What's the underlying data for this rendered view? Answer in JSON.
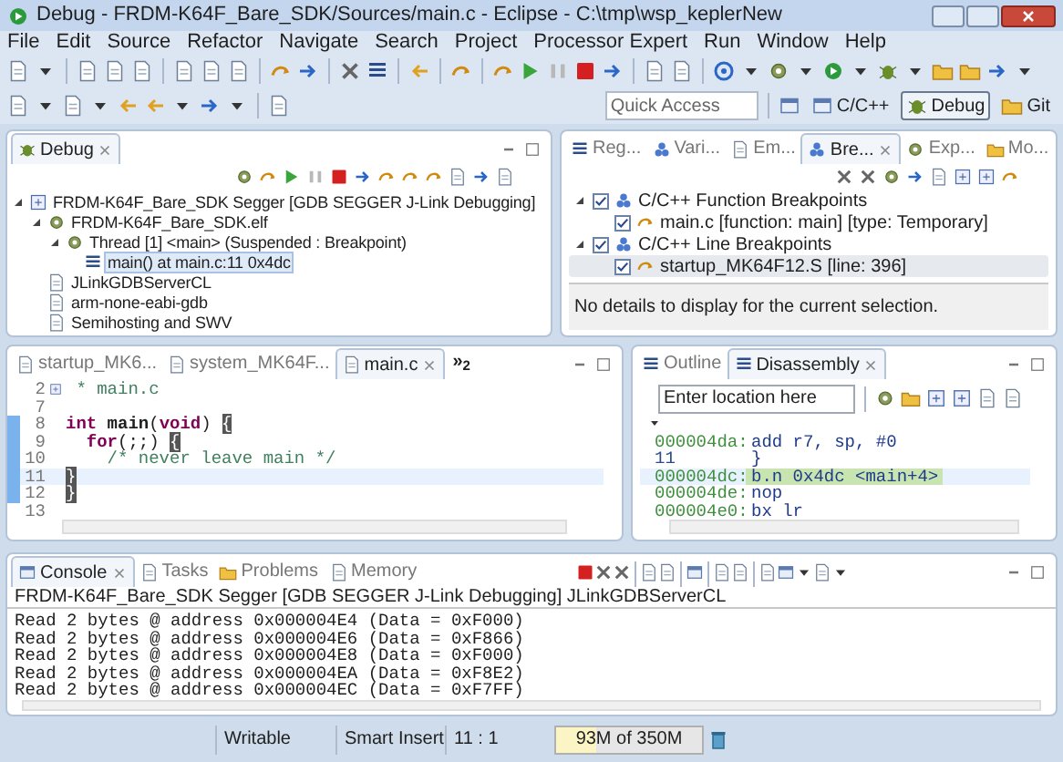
{
  "window": {
    "title": "Debug - FRDM-K64F_Bare_SDK/Sources/main.c - Eclipse - C:\\tmp\\wsp_keplerNew"
  },
  "menu": [
    "File",
    "Edit",
    "Source",
    "Refactor",
    "Navigate",
    "Search",
    "Project",
    "Processor Expert",
    "Run",
    "Window",
    "Help"
  ],
  "quick_access": {
    "placeholder": "Quick Access"
  },
  "perspectives": [
    {
      "label": "C/C++",
      "selected": false
    },
    {
      "label": "Debug",
      "selected": true
    },
    {
      "label": "Git",
      "selected": false
    }
  ],
  "debug_view": {
    "tab": "Debug",
    "tree": [
      {
        "label": "FRDM-K64F_Bare_SDK Segger [GDB SEGGER J-Link Debugging]",
        "kind": "launch",
        "expanded": true,
        "selected": false,
        "children": [
          {
            "label": "FRDM-K64F_Bare_SDK.elf",
            "kind": "program",
            "expanded": true,
            "selected": false,
            "children": [
              {
                "label": "Thread [1] <main> (Suspended : Breakpoint)",
                "kind": "thread",
                "expanded": true,
                "selected": false,
                "children": [
                  {
                    "label": "main() at main.c:11 0x4dc",
                    "kind": "frame",
                    "selected": true
                  }
                ]
              }
            ]
          },
          {
            "label": "JLinkGDBServerCL",
            "kind": "process",
            "selected": false
          },
          {
            "label": "arm-none-eabi-gdb",
            "kind": "process",
            "selected": false
          },
          {
            "label": "Semihosting and SWV",
            "kind": "process",
            "selected": false
          }
        ]
      }
    ]
  },
  "breakpoints_view": {
    "tabs": [
      {
        "label": "Reg...",
        "selected": false
      },
      {
        "label": "Vari...",
        "selected": false
      },
      {
        "label": "Em...",
        "selected": false
      },
      {
        "label": "Bre...",
        "selected": true
      },
      {
        "label": "Exp...",
        "selected": false
      },
      {
        "label": "Mo...",
        "selected": false
      }
    ],
    "tree": [
      {
        "label": "C/C++ Function Breakpoints",
        "checked": true,
        "expanded": true,
        "selected": false,
        "children": [
          {
            "label": "main.c [function: main] [type: Temporary]",
            "checked": true,
            "selected": false
          }
        ]
      },
      {
        "label": "C/C++ Line Breakpoints",
        "checked": true,
        "expanded": true,
        "selected": false,
        "children": [
          {
            "label": "startup_MK64F12.S [line: 396]",
            "checked": true,
            "selected": true
          }
        ]
      }
    ],
    "details": "No details to display for the current selection."
  },
  "editor": {
    "tabs": [
      {
        "label": "startup_MK6...",
        "selected": false
      },
      {
        "label": "system_MK64F...",
        "selected": false
      },
      {
        "label": "main.c",
        "selected": true
      }
    ],
    "overflow": {
      "glyph": "»",
      "count": "2"
    },
    "lines": [
      {
        "number": "2",
        "folded": true,
        "changed": false,
        "current": false,
        "segments": [
          {
            "kind": "comment",
            "text": " * main.c"
          }
        ]
      },
      {
        "number": "7",
        "changed": false,
        "current": false
      },
      {
        "number": "8",
        "changed": true,
        "current": false,
        "segments": [
          {
            "kind": "keyword",
            "text": "int"
          },
          {
            "kind": "bold",
            "text": " main"
          },
          {
            "kind": "plain",
            "text": "("
          },
          {
            "kind": "keyword",
            "text": "void"
          },
          {
            "kind": "plain",
            "text": ") "
          },
          {
            "kind": "bracket",
            "text": "{"
          }
        ]
      },
      {
        "number": "9",
        "changed": true,
        "current": false,
        "segments": [
          {
            "kind": "keyword",
            "text": "  for"
          },
          {
            "kind": "plain",
            "text": "(;;) "
          },
          {
            "kind": "bracket",
            "text": "{"
          }
        ]
      },
      {
        "number": "10",
        "changed": true,
        "current": false,
        "segments": [
          {
            "kind": "comment",
            "text": "    /* never leave main */"
          }
        ]
      },
      {
        "number": "11",
        "changed": true,
        "current": true,
        "segments": [
          {
            "kind": "bracket",
            "text": "}"
          }
        ]
      },
      {
        "number": "12",
        "changed": true,
        "current": false,
        "segments": [
          {
            "kind": "bracket",
            "text": "}"
          }
        ]
      },
      {
        "number": "13",
        "changed": false,
        "current": false
      }
    ]
  },
  "disassembly_view": {
    "tabs": [
      {
        "label": "Outline",
        "selected": false
      },
      {
        "label": "Disassembly",
        "selected": true
      }
    ],
    "location": {
      "placeholder": "Enter location here"
    },
    "rows": [
      {
        "kind": "asm",
        "address": "000004da:",
        "instruction": "add r7, sp, #0",
        "current": false
      },
      {
        "kind": "source",
        "address": "11",
        "instruction": "}",
        "current": false
      },
      {
        "kind": "asm",
        "address": "000004dc:",
        "instruction": "b.n 0x4dc <main+4>",
        "current": true
      },
      {
        "kind": "asm",
        "address": "000004de:",
        "instruction": "nop",
        "current": false
      },
      {
        "kind": "asm",
        "address": "000004e0:",
        "instruction": "bx lr",
        "current": false
      }
    ]
  },
  "console": {
    "tabs": [
      {
        "label": "Console",
        "selected": true
      },
      {
        "label": "Tasks",
        "selected": false
      },
      {
        "label": "Problems",
        "selected": false
      },
      {
        "label": "Memory",
        "selected": false
      }
    ],
    "process": "FRDM-K64F_Bare_SDK Segger [GDB SEGGER J-Link Debugging] JLinkGDBServerCL",
    "lines": [
      "Read 2 bytes @ address 0x000004E4 (Data = 0xF000)",
      "Read 2 bytes @ address 0x000004E6 (Data = 0xF866)",
      "Read 2 bytes @ address 0x000004E8 (Data = 0xF000)",
      "Read 2 bytes @ address 0x000004EA (Data = 0xF8E2)",
      "Read 2 bytes @ address 0x000004EC (Data = 0xF7FF)"
    ]
  },
  "status_bar": {
    "mode": "Writable",
    "insert": "Smart Insert",
    "position": "11 : 1",
    "heap": {
      "text": "93M of 350M",
      "level": 0.27
    }
  }
}
